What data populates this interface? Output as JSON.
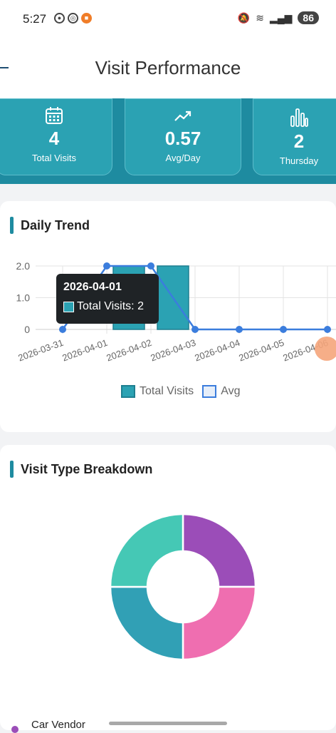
{
  "status_bar": {
    "time": "5:27",
    "battery": "86"
  },
  "header": {
    "title": "Visit Performance"
  },
  "stats": [
    {
      "icon": "calendar-icon",
      "value": "4",
      "label": "Total Visits"
    },
    {
      "icon": "trending-up-icon",
      "value": "0.57",
      "label": "Avg/Day"
    },
    {
      "icon": "bar-chart-icon",
      "value": "2",
      "label": "Thursday"
    }
  ],
  "daily_trend": {
    "title": "Daily Trend",
    "tooltip": {
      "date": "2026-04-01",
      "text": "Total Visits: 2"
    },
    "legend": {
      "total": "Total Visits",
      "avg": "Avg"
    }
  },
  "visit_type": {
    "title": "Visit Type Breakdown",
    "legend_first": "Car Vendor"
  },
  "colors": {
    "accent": "#1e8ba0",
    "bar": "#2ba2b3",
    "line": "#3b7ddd"
  },
  "chart_data": [
    {
      "type": "bar",
      "categories": [
        "2026-03-31",
        "2026-04-01",
        "2026-04-02",
        "2026-04-03",
        "2026-04-04",
        "2026-04-05",
        "2026-04-06"
      ],
      "series": [
        {
          "name": "Total Visits",
          "type": "bar",
          "values": [
            0,
            2,
            2,
            0,
            0,
            0,
            0
          ]
        },
        {
          "name": "Avg",
          "type": "line",
          "values": [
            0,
            2,
            2,
            0,
            0,
            0,
            0
          ]
        }
      ],
      "yticks": [
        "0",
        "1.0",
        "2.0"
      ],
      "ylim": [
        0,
        2
      ],
      "grid": true,
      "legend": "bottom"
    },
    {
      "type": "pie",
      "labels": [
        "Car Vendor",
        "",
        "",
        ""
      ],
      "values": [
        25,
        25,
        25,
        25
      ],
      "colors": [
        "#9b4db8",
        "#ef6eb0",
        "#31a0b5",
        "#45c8b5"
      ]
    }
  ]
}
